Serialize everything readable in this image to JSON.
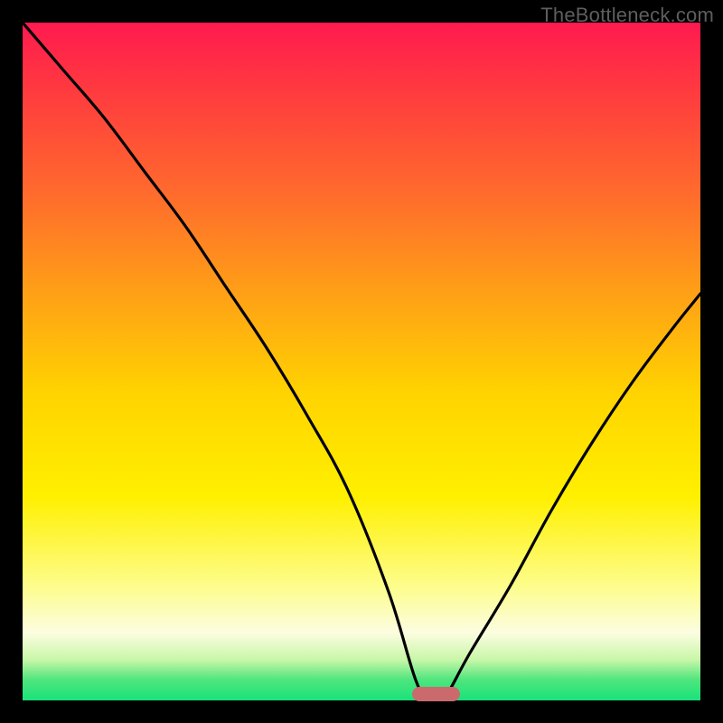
{
  "watermark": "TheBottleneck.com",
  "chart_data": {
    "type": "line",
    "title": "",
    "xlabel": "",
    "ylabel": "",
    "xlim": [
      0,
      100
    ],
    "ylim": [
      0,
      100
    ],
    "grid": false,
    "legend": false,
    "series": [
      {
        "name": "bottleneck-curve",
        "x": [
          0,
          6,
          12,
          18,
          24,
          30,
          36,
          42,
          48,
          54,
          58,
          60,
          62,
          66,
          72,
          78,
          84,
          90,
          96,
          100
        ],
        "values": [
          100,
          93,
          86,
          78,
          70,
          61,
          52,
          42,
          31,
          16,
          3,
          0,
          0,
          7,
          17,
          28,
          38,
          47,
          55,
          60
        ]
      }
    ],
    "marker": {
      "x_center": 61,
      "y": 1,
      "width_pct": 7
    },
    "background_gradient": {
      "top": "#ff1a4f",
      "mid_high": "#ffa016",
      "mid": "#fff000",
      "mid_low": "#fcfde0",
      "bottom": "#19e27a"
    }
  }
}
